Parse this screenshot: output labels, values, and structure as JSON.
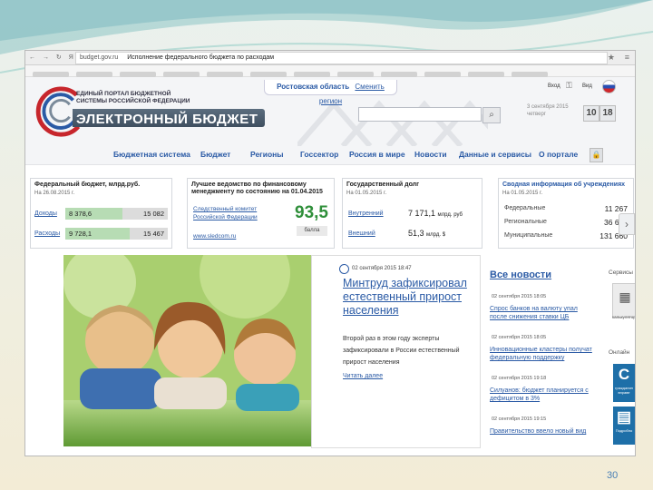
{
  "browser": {
    "nav_glyphs": "← → ↻ Я",
    "url_domain": "budget.gov.ru",
    "page_title": "Исполнение федерального бюджета по расходам",
    "star_icon": "star-icon",
    "menu_icon": "menu-icon"
  },
  "header": {
    "portal_name": "ЕДИНЫЙ ПОРТАЛ БЮДЖЕТНОЙ СИСТЕМЫ РОССИЙСКОЙ ФЕДЕРАЦИИ",
    "brand": "ЭЛЕКТРОННЫЙ БЮДЖЕТ",
    "region": "Ростовская область",
    "change_region": "Сменить регион",
    "login": "Вход",
    "lang": "Вид",
    "date_line1": "3 сентября 2015",
    "date_line2": "четверг",
    "counter": [
      "10",
      "18"
    ],
    "search_icon": "search-icon"
  },
  "menu": [
    "Бюджетная система",
    "Бюджет",
    "Регионы",
    "Госсектор",
    "Россия в мире",
    "Новости",
    "Данные и сервисы",
    "О портале"
  ],
  "panels": {
    "federal": {
      "title": "Федеральный бюджет, млрд.руб.",
      "date": "На 26.08.2015 г.",
      "rows": [
        {
          "label": "Доходы",
          "fact": "8 378,6",
          "plan": "15 082",
          "fraction": 0.56
        },
        {
          "label": "Расходы",
          "fact": "9 728,1",
          "plan": "15 467",
          "fraction": 0.63
        }
      ]
    },
    "best": {
      "title": "Лучшее ведомство по финансовому менеджменту по состоянию на 01.04.2015",
      "org": "Следственный комитет Российской Федерации",
      "link": "www.sledcom.ru",
      "score": "93,5",
      "score_label": "балла"
    },
    "debt": {
      "title": "Государственный долг",
      "date": "На 01.05.2015 г.",
      "rows": [
        {
          "label": "Внутренний",
          "value": "7 171,1",
          "unit": "млрд. руб"
        },
        {
          "label": "Внешний",
          "value": "51,3",
          "unit": "млрд. $"
        }
      ]
    },
    "summary": {
      "title": "Сводная информация об учреждениях",
      "date": "На 01.05.2015 г.",
      "rows": [
        {
          "label": "Федеральные",
          "value": "11 267"
        },
        {
          "label": "Региональные",
          "value": "36 606"
        },
        {
          "label": "Муниципальные",
          "value": "131 660"
        }
      ]
    }
  },
  "main_news": {
    "date": "02 сентября 2015 18:47",
    "title": "Минтруд зафиксировал естественный прирост населения",
    "text": "Второй раз в этом году эксперты зафиксировали в России естественный прирост населения",
    "more": "Читать далее"
  },
  "news": {
    "header": "Все новости",
    "items": [
      {
        "date": "02 сентября 2015 18:05",
        "title": "Спрос банков на валюту упал после снижения ставки ЦБ"
      },
      {
        "date": "02 сентября 2015 18:05",
        "title": "Инновационные кластеры получат федеральную поддержку"
      },
      {
        "date": "02 сентября 2015 19:18",
        "title": "Силуанов: бюджет планируется с дефицитом в 3%"
      },
      {
        "date": "02 сентября 2015 19:15",
        "title": "Правительство ввело новый вид"
      }
    ]
  },
  "services": {
    "header": "Сервисы",
    "calc_label": "калькулятор",
    "header2": "Онлайн",
    "tiles": [
      {
        "glyph": "С",
        "caption": "гражданин вправе"
      },
      {
        "glyph": "▤",
        "caption": "Подробно"
      }
    ]
  },
  "slide": {
    "page_number": "30"
  }
}
